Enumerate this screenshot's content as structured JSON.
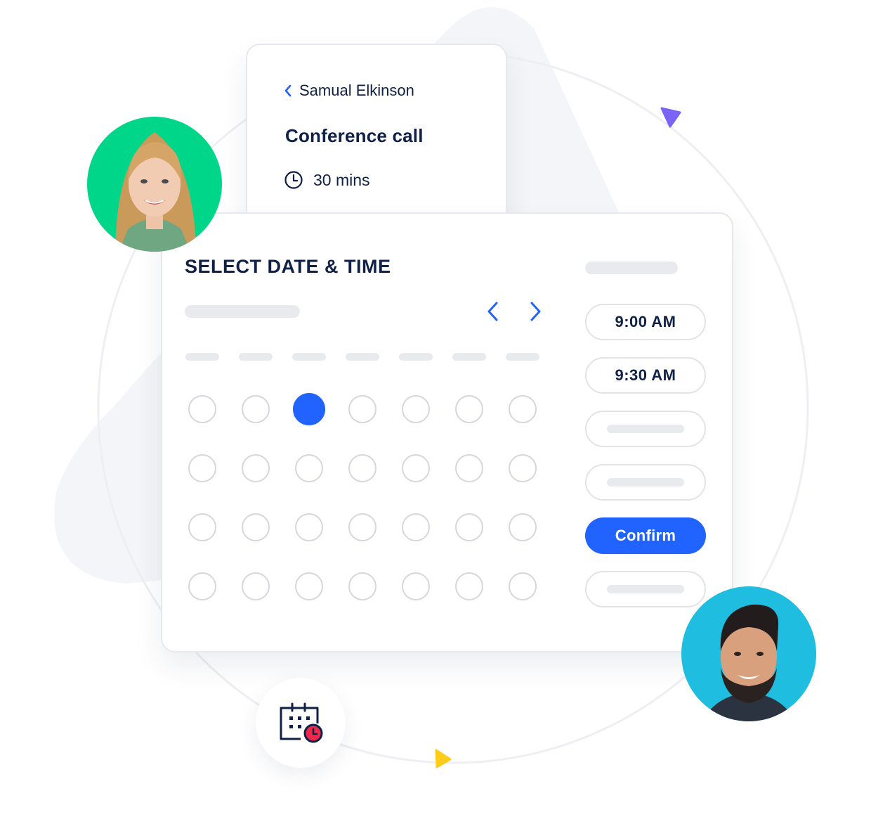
{
  "event_card": {
    "back_label": "Samual Elkinson",
    "title": "Conference call",
    "duration": "30 mins"
  },
  "scheduler": {
    "title": "SELECT DATE & TIME",
    "calendar": {
      "rows": 4,
      "columns": 7,
      "selected_day": {
        "row": 1,
        "column": 3
      }
    },
    "time_slots": [
      {
        "label": "9:00 AM"
      },
      {
        "label": "9:30 AM"
      },
      {
        "label": ""
      },
      {
        "label": ""
      }
    ],
    "confirm_label": "Confirm",
    "trailing_slot": {
      "label": ""
    }
  },
  "colors": {
    "accent": "#2163ff",
    "text": "#0f2147",
    "avatar_left_bg": "#00d68a",
    "avatar_right_bg": "#1fbee0",
    "triangle_purple": "#7a63f5",
    "triangle_yellow": "#ffcc1a",
    "clock_badge": "#ee2a4a"
  },
  "avatars": [
    {
      "name": "woman-avatar"
    },
    {
      "name": "man-avatar"
    }
  ]
}
